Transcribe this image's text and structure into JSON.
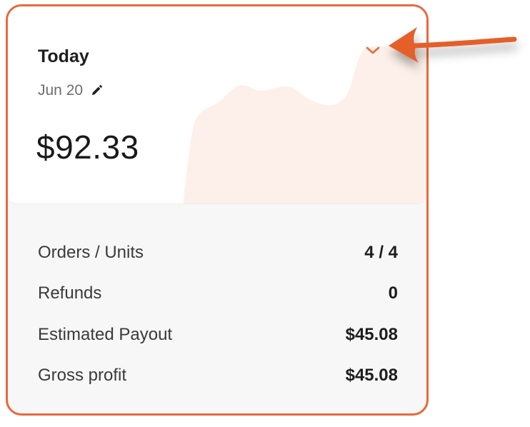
{
  "card": {
    "title": "Today",
    "date": "Jun 20",
    "amount": "$92.33",
    "edit_icon": "pencil-icon",
    "expand_icon": "chevron-down-icon"
  },
  "stats": [
    {
      "label": "Orders / Units",
      "value": "4 / 4"
    },
    {
      "label": "Refunds",
      "value": "0"
    },
    {
      "label": "Estimated Payout",
      "value": "$45.08"
    },
    {
      "label": "Gross profit",
      "value": "$45.08"
    }
  ],
  "colors": {
    "accent": "#e8693c",
    "sparkline_fill": "#fdf0ea",
    "card_bottom_bg": "#f7f7f7"
  }
}
